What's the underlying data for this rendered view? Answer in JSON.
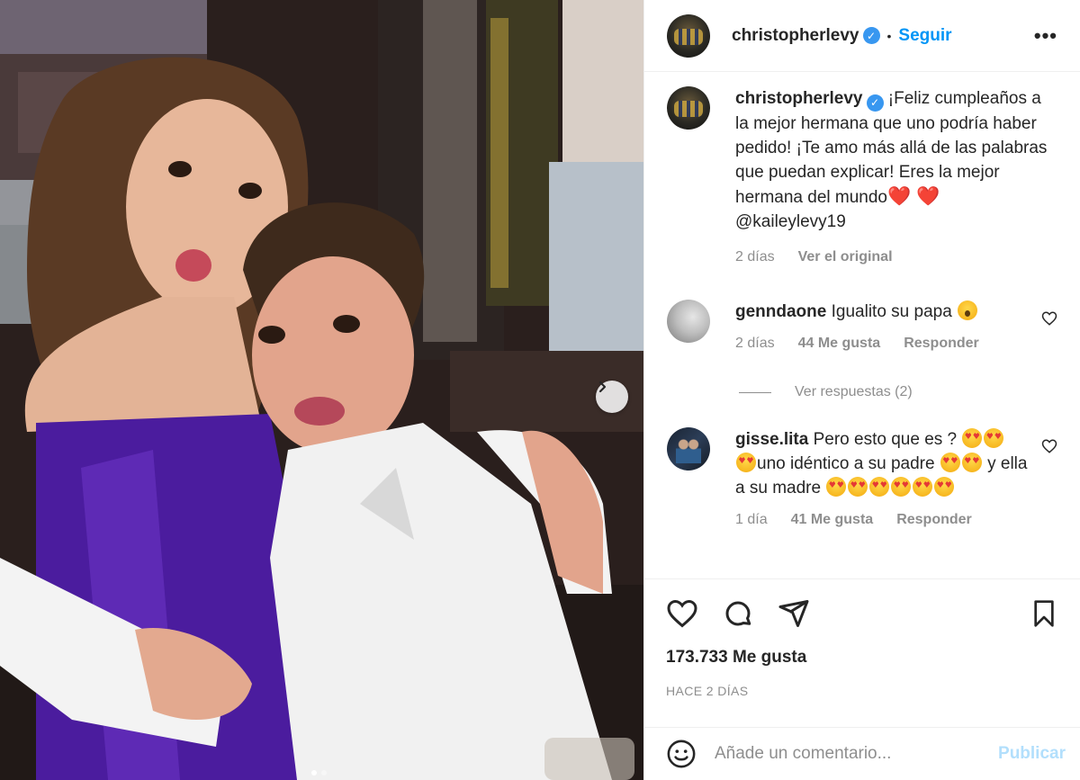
{
  "post": {
    "username": "christopherlevy",
    "follow_label": "Seguir",
    "dot": "•",
    "more_glyph": "•••"
  },
  "caption": {
    "username": "christopherlevy",
    "text": "¡Feliz cumpleaños a la mejor hermana que uno podría haber pedido! ¡Te amo más allá de las palabras que puedan explicar! Eres la mejor hermana del mundo",
    "hearts": "❤️ ❤️",
    "mention": "@kaileylevy19",
    "time": "2 días",
    "see_original": "Ver el original"
  },
  "comments": [
    {
      "username": "genndaone",
      "text": "Igualito su papa",
      "time": "2 días",
      "likes": "44 Me gusta",
      "reply": "Responder",
      "view_replies": "Ver respuestas (2)"
    },
    {
      "username": "gisse.lita",
      "text_1": "Pero esto que es ?",
      "text_2": "uno idéntico a su padre",
      "text_3": "y ella a su madre",
      "time": "1 día",
      "likes": "41 Me gusta",
      "reply": "Responder"
    }
  ],
  "stats": {
    "likes": "173.733 Me gusta",
    "posted": "HACE 2 DÍAS"
  },
  "composer": {
    "placeholder": "Añade un comentario...",
    "publish": "Publicar"
  },
  "colors": {
    "accent": "#0095f6",
    "verified": "#3897f0",
    "muted": "#8e8e8e",
    "dress": "#4b1c9e"
  }
}
